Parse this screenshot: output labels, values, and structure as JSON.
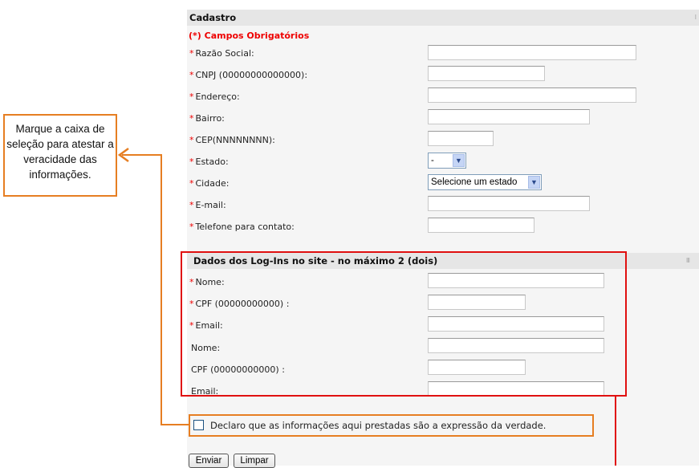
{
  "cadastro": {
    "title": "Cadastro",
    "required_note": "(*) Campos Obrigatórios",
    "fields": [
      {
        "star": "*",
        "label": "Razão Social:"
      },
      {
        "star": "*",
        "label": "CNPJ (00000000000000):"
      },
      {
        "star": "*",
        "label": "Endereço:"
      },
      {
        "star": "*",
        "label": "Bairro:"
      },
      {
        "star": "*",
        "label": "CEP(NNNNNNNN):"
      },
      {
        "star": "*",
        "label": "Estado:",
        "select_value": "-"
      },
      {
        "star": "*",
        "label": "Cidade:",
        "select_value": "Selecione um estado"
      },
      {
        "star": "*",
        "label": "E-mail:"
      },
      {
        "star": "*",
        "label": "Telefone para contato:"
      }
    ]
  },
  "logins": {
    "title": "Dados dos Log-Ins no site - no máximo 2 (dois)",
    "fields": [
      {
        "star": "*",
        "label": "Nome:"
      },
      {
        "star": "*",
        "label": "CPF (00000000000) :"
      },
      {
        "star": "*",
        "label": "Email:"
      },
      {
        "star": "",
        "label": "Nome:"
      },
      {
        "star": "",
        "label": "CPF (00000000000) :"
      },
      {
        "star": "",
        "label": "Email:"
      }
    ]
  },
  "declaration": {
    "label": "Declaro que as informações aqui prestadas são a expressão da verdade.",
    "checked": false
  },
  "buttons": {
    "submit": "Enviar",
    "clear": "Limpar"
  },
  "callout": {
    "text": "Marque a caixa de seleção para atestar a veracidade das informações."
  },
  "colors": {
    "required": "#e00000",
    "highlight_red": "#e01010",
    "highlight_orange": "#e67e22"
  }
}
